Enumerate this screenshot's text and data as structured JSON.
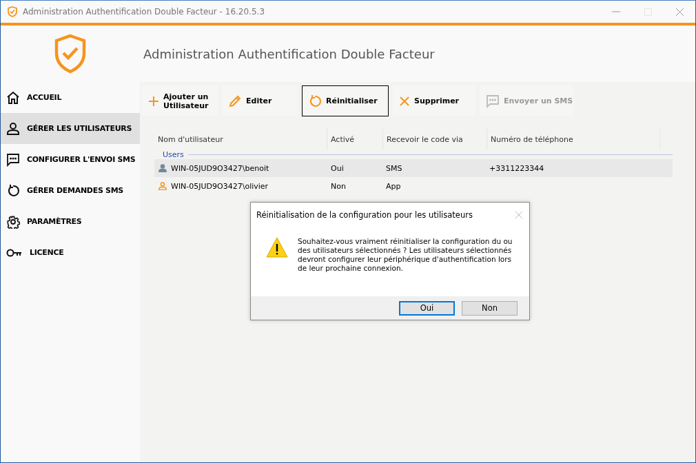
{
  "window": {
    "title": "Administration Authentification Double Facteur - 16.20.5.3"
  },
  "header": {
    "title": "Administration Authentification Double Facteur"
  },
  "sidebar": {
    "items": [
      {
        "label": "ACCUEIL",
        "selected": false
      },
      {
        "label": "GÉRER LES UTILISATEURS",
        "selected": true
      },
      {
        "label": "CONFIGURER L'ENVOI SMS",
        "selected": false
      },
      {
        "label": "GÉRER DEMANDES SMS",
        "selected": false
      },
      {
        "label": "PARAMÈTRES",
        "selected": false
      },
      {
        "label": "LICENCE",
        "selected": false
      }
    ]
  },
  "toolbar": [
    {
      "label": "Ajouter un Utilisateur",
      "focused": false,
      "disabled": false
    },
    {
      "label": "Editer",
      "focused": false,
      "disabled": false
    },
    {
      "label": "Réinitialiser",
      "focused": true,
      "disabled": false
    },
    {
      "label": "Supprimer",
      "focused": false,
      "disabled": false
    },
    {
      "label": "Envoyer un SMS",
      "focused": false,
      "disabled": true
    }
  ],
  "table": {
    "columns": [
      "Nom d'utilisateur",
      "Activé",
      "Recevoir le code via",
      "Numéro de téléphone"
    ],
    "group": "Users",
    "rows": [
      {
        "cells": [
          "WIN-05JUD9O3427\\benoit",
          "Oui",
          "SMS",
          "+3311223344"
        ],
        "color": "#6e8a99",
        "selected": true
      },
      {
        "cells": [
          "WIN-05JUD9O3427\\olivier",
          "Non",
          "App",
          ""
        ],
        "color": "#f7941d",
        "selected": false
      }
    ]
  },
  "dialog": {
    "title": "Réinitialisation de la configuration pour les utilisateurs",
    "message": "Souhaitez-vous vraiment réinitialiser la configuration du ou des utilisateurs sélectionnés ? Les utilisateurs sélectionnés devront configurer leur périphérique d'authentification lors de leur prochaine connexion.",
    "buttons": [
      {
        "label": "Oui",
        "default": true
      },
      {
        "label": "Non",
        "default": false
      }
    ]
  }
}
